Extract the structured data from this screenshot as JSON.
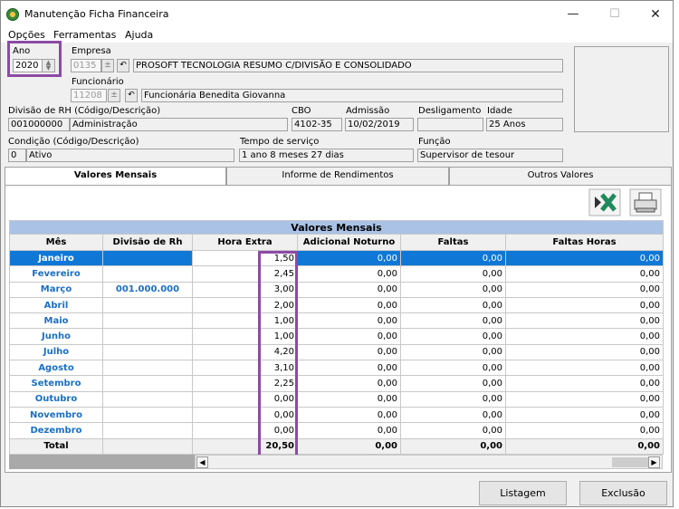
{
  "window": {
    "title": "Manutenção Ficha Financeira",
    "min_glyph": "—",
    "max_glyph": "☐",
    "close_glyph": "✕"
  },
  "menu": [
    "Opções",
    "Ferramentas",
    "Ajuda"
  ],
  "header": {
    "ano_label": "Ano",
    "ano_value": "2020",
    "empresa_label": "Empresa",
    "empresa_code": "0135",
    "empresa_name": "PROSOFT TECNOLOGIA RESUMO C/DIVISÃO E CONSOLIDADO",
    "funcionario_label": "Funcionário",
    "funcionario_code": "11208",
    "funcionario_name": "Funcionária Benedita Giovanna",
    "divisao_label": "Divisão de RH (Código/Descrição)",
    "divisao_code": "001000000",
    "divisao_desc": "Administração",
    "cbo_label": "CBO",
    "cbo_value": "4102-35",
    "admissao_label": "Admissão",
    "admissao_value": "10/02/2019",
    "desligamento_label": "Desligamento",
    "desligamento_value": "",
    "idade_label": "Idade",
    "idade_value": "25 Anos",
    "condicao_label": "Condição (Código/Descrição)",
    "condicao_code": "0",
    "condicao_desc": "Ativo",
    "tempo_label": "Tempo de serviço",
    "tempo_value": "1 ano 8 meses 27 dias",
    "funcao_label": "Função",
    "funcao_value": "Supervisor de tesour"
  },
  "tabs": [
    "Valores Mensais",
    "Informe de Rendimentos",
    "Outros Valores"
  ],
  "grid": {
    "caption": "Valores Mensais",
    "columns": [
      "Mês",
      "Divisão de Rh",
      "Hora Extra",
      "Adicional Noturno",
      "Faltas",
      "Faltas Horas"
    ],
    "rows": [
      [
        "Janeiro",
        "",
        "1,50",
        "0,00",
        "0,00",
        "0,00"
      ],
      [
        "Fevereiro",
        "",
        "2,45",
        "0,00",
        "0,00",
        "0,00"
      ],
      [
        "Março",
        "001.000.000",
        "3,00",
        "0,00",
        "0,00",
        "0,00"
      ],
      [
        "Abril",
        "",
        "2,00",
        "0,00",
        "0,00",
        "0,00"
      ],
      [
        "Maio",
        "",
        "1,00",
        "0,00",
        "0,00",
        "0,00"
      ],
      [
        "Junho",
        "",
        "1,00",
        "0,00",
        "0,00",
        "0,00"
      ],
      [
        "Julho",
        "",
        "4,20",
        "0,00",
        "0,00",
        "0,00"
      ],
      [
        "Agosto",
        "",
        "3,10",
        "0,00",
        "0,00",
        "0,00"
      ],
      [
        "Setembro",
        "",
        "2,25",
        "0,00",
        "0,00",
        "0,00"
      ],
      [
        "Outubro",
        "",
        "0,00",
        "0,00",
        "0,00",
        "0,00"
      ],
      [
        "Novembro",
        "",
        "0,00",
        "0,00",
        "0,00",
        "0,00"
      ],
      [
        "Dezembro",
        "",
        "0,00",
        "0,00",
        "0,00",
        "0,00"
      ]
    ],
    "total": [
      "Total",
      "",
      "20,50",
      "0,00",
      "0,00",
      "0,00"
    ]
  },
  "buttons": {
    "listagem": "Listagem",
    "exclusao": "Exclusão"
  },
  "colors": {
    "selection": "#0f78d7",
    "highlight": "#8d4aa5",
    "caption_bg": "#a9c2e6",
    "month_text": "#1a6fc7"
  }
}
